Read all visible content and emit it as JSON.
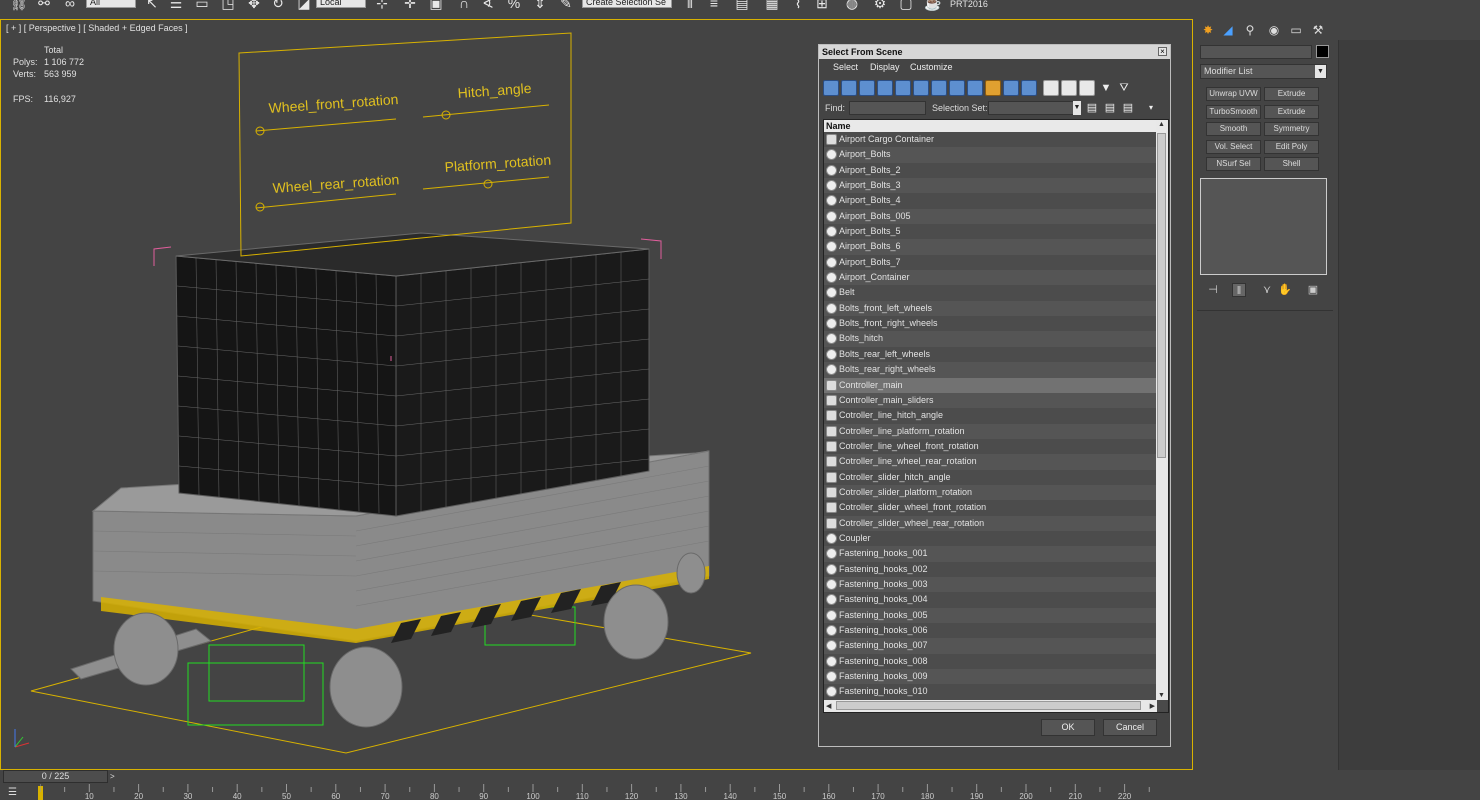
{
  "toolbar": {
    "reference_dropdown": "Local",
    "selection_set_dropdown": "Create Selection Se",
    "filter_dropdown": "All",
    "version_label": "PRT2016",
    "colors": {
      "accent": "#d8b200"
    }
  },
  "viewport": {
    "label": "[ + ] [ Perspective ] [ Shaded + Edged Faces ]",
    "stats": {
      "total_label": "Total",
      "polys_label": "Polys:",
      "polys_value": "1 106 772",
      "verts_label": "Verts:",
      "verts_value": "563 959",
      "fps_label": "FPS:",
      "fps_value": "116,927"
    },
    "controller_labels": {
      "wheel_front": "Wheel_front_rotation",
      "hitch": "Hitch_angle",
      "wheel_rear": "Wheel_rear_rotation",
      "platform": "Platform_rotation"
    }
  },
  "dialog": {
    "title": "Select From Scene",
    "close_glyph": "×",
    "menu": [
      "Select",
      "Display",
      "Customize"
    ],
    "find_label": "Find:",
    "find_value": "",
    "selection_set_label": "Selection Set:",
    "selection_set_value": "",
    "list_header": "Name",
    "items": [
      {
        "name": "Airport Cargo Container",
        "type": "helper"
      },
      {
        "name": "Airport_Bolts",
        "type": "geometry"
      },
      {
        "name": "Airport_Bolts_2",
        "type": "geometry"
      },
      {
        "name": "Airport_Bolts_3",
        "type": "geometry"
      },
      {
        "name": "Airport_Bolts_4",
        "type": "geometry"
      },
      {
        "name": "Airport_Bolts_005",
        "type": "geometry"
      },
      {
        "name": "Airport_Bolts_5",
        "type": "geometry"
      },
      {
        "name": "Airport_Bolts_6",
        "type": "geometry"
      },
      {
        "name": "Airport_Bolts_7",
        "type": "geometry"
      },
      {
        "name": "Airport_Container",
        "type": "geometry"
      },
      {
        "name": "Belt",
        "type": "geometry"
      },
      {
        "name": "Bolts_front_left_wheels",
        "type": "geometry"
      },
      {
        "name": "Bolts_front_right_wheels",
        "type": "geometry"
      },
      {
        "name": "Bolts_hitch",
        "type": "geometry"
      },
      {
        "name": "Bolts_rear_left_wheels",
        "type": "geometry"
      },
      {
        "name": "Bolts_rear_right_wheels",
        "type": "geometry"
      },
      {
        "name": "Controller_main",
        "type": "helper",
        "selected": true
      },
      {
        "name": "Controller_main_sliders",
        "type": "helper"
      },
      {
        "name": "Cotroller_line_hitch_angle",
        "type": "helper"
      },
      {
        "name": "Cotroller_line_platform_rotation",
        "type": "helper"
      },
      {
        "name": "Cotroller_line_wheel_front_rotation",
        "type": "helper"
      },
      {
        "name": "Cotroller_line_wheel_rear_rotation",
        "type": "helper"
      },
      {
        "name": "Cotroller_slider_hitch_angle",
        "type": "helper"
      },
      {
        "name": "Cotroller_slider_platform_rotation",
        "type": "helper"
      },
      {
        "name": "Cotroller_slider_wheel_front_rotation",
        "type": "helper"
      },
      {
        "name": "Cotroller_slider_wheel_rear_rotation",
        "type": "helper"
      },
      {
        "name": "Coupler",
        "type": "geometry"
      },
      {
        "name": "Fastening_hooks_001",
        "type": "geometry"
      },
      {
        "name": "Fastening_hooks_002",
        "type": "geometry"
      },
      {
        "name": "Fastening_hooks_003",
        "type": "geometry"
      },
      {
        "name": "Fastening_hooks_004",
        "type": "geometry"
      },
      {
        "name": "Fastening_hooks_005",
        "type": "geometry"
      },
      {
        "name": "Fastening_hooks_006",
        "type": "geometry"
      },
      {
        "name": "Fastening_hooks_007",
        "type": "geometry"
      },
      {
        "name": "Fastening_hooks_008",
        "type": "geometry"
      },
      {
        "name": "Fastening_hooks_009",
        "type": "geometry"
      },
      {
        "name": "Fastening_hooks_010",
        "type": "geometry"
      }
    ],
    "ok_label": "OK",
    "cancel_label": "Cancel"
  },
  "command_panel": {
    "modifier_list_label": "Modifier List",
    "buttons": [
      [
        "Unwrap UVW",
        "Extrude"
      ],
      [
        "TurboSmooth",
        "Extrude"
      ],
      [
        "Smooth",
        "Symmetry"
      ],
      [
        "Vol. Select",
        "Edit Poly"
      ],
      [
        "NSurf Sel",
        "Shell"
      ]
    ]
  },
  "timeline": {
    "frame_display": "0 / 225",
    "next_glyph": ">",
    "ticks": [
      "10",
      "20",
      "30",
      "40",
      "50",
      "60",
      "70",
      "80",
      "90",
      "100",
      "110",
      "120",
      "130",
      "140",
      "150",
      "160",
      "170",
      "180",
      "190",
      "200",
      "210",
      "220"
    ]
  }
}
